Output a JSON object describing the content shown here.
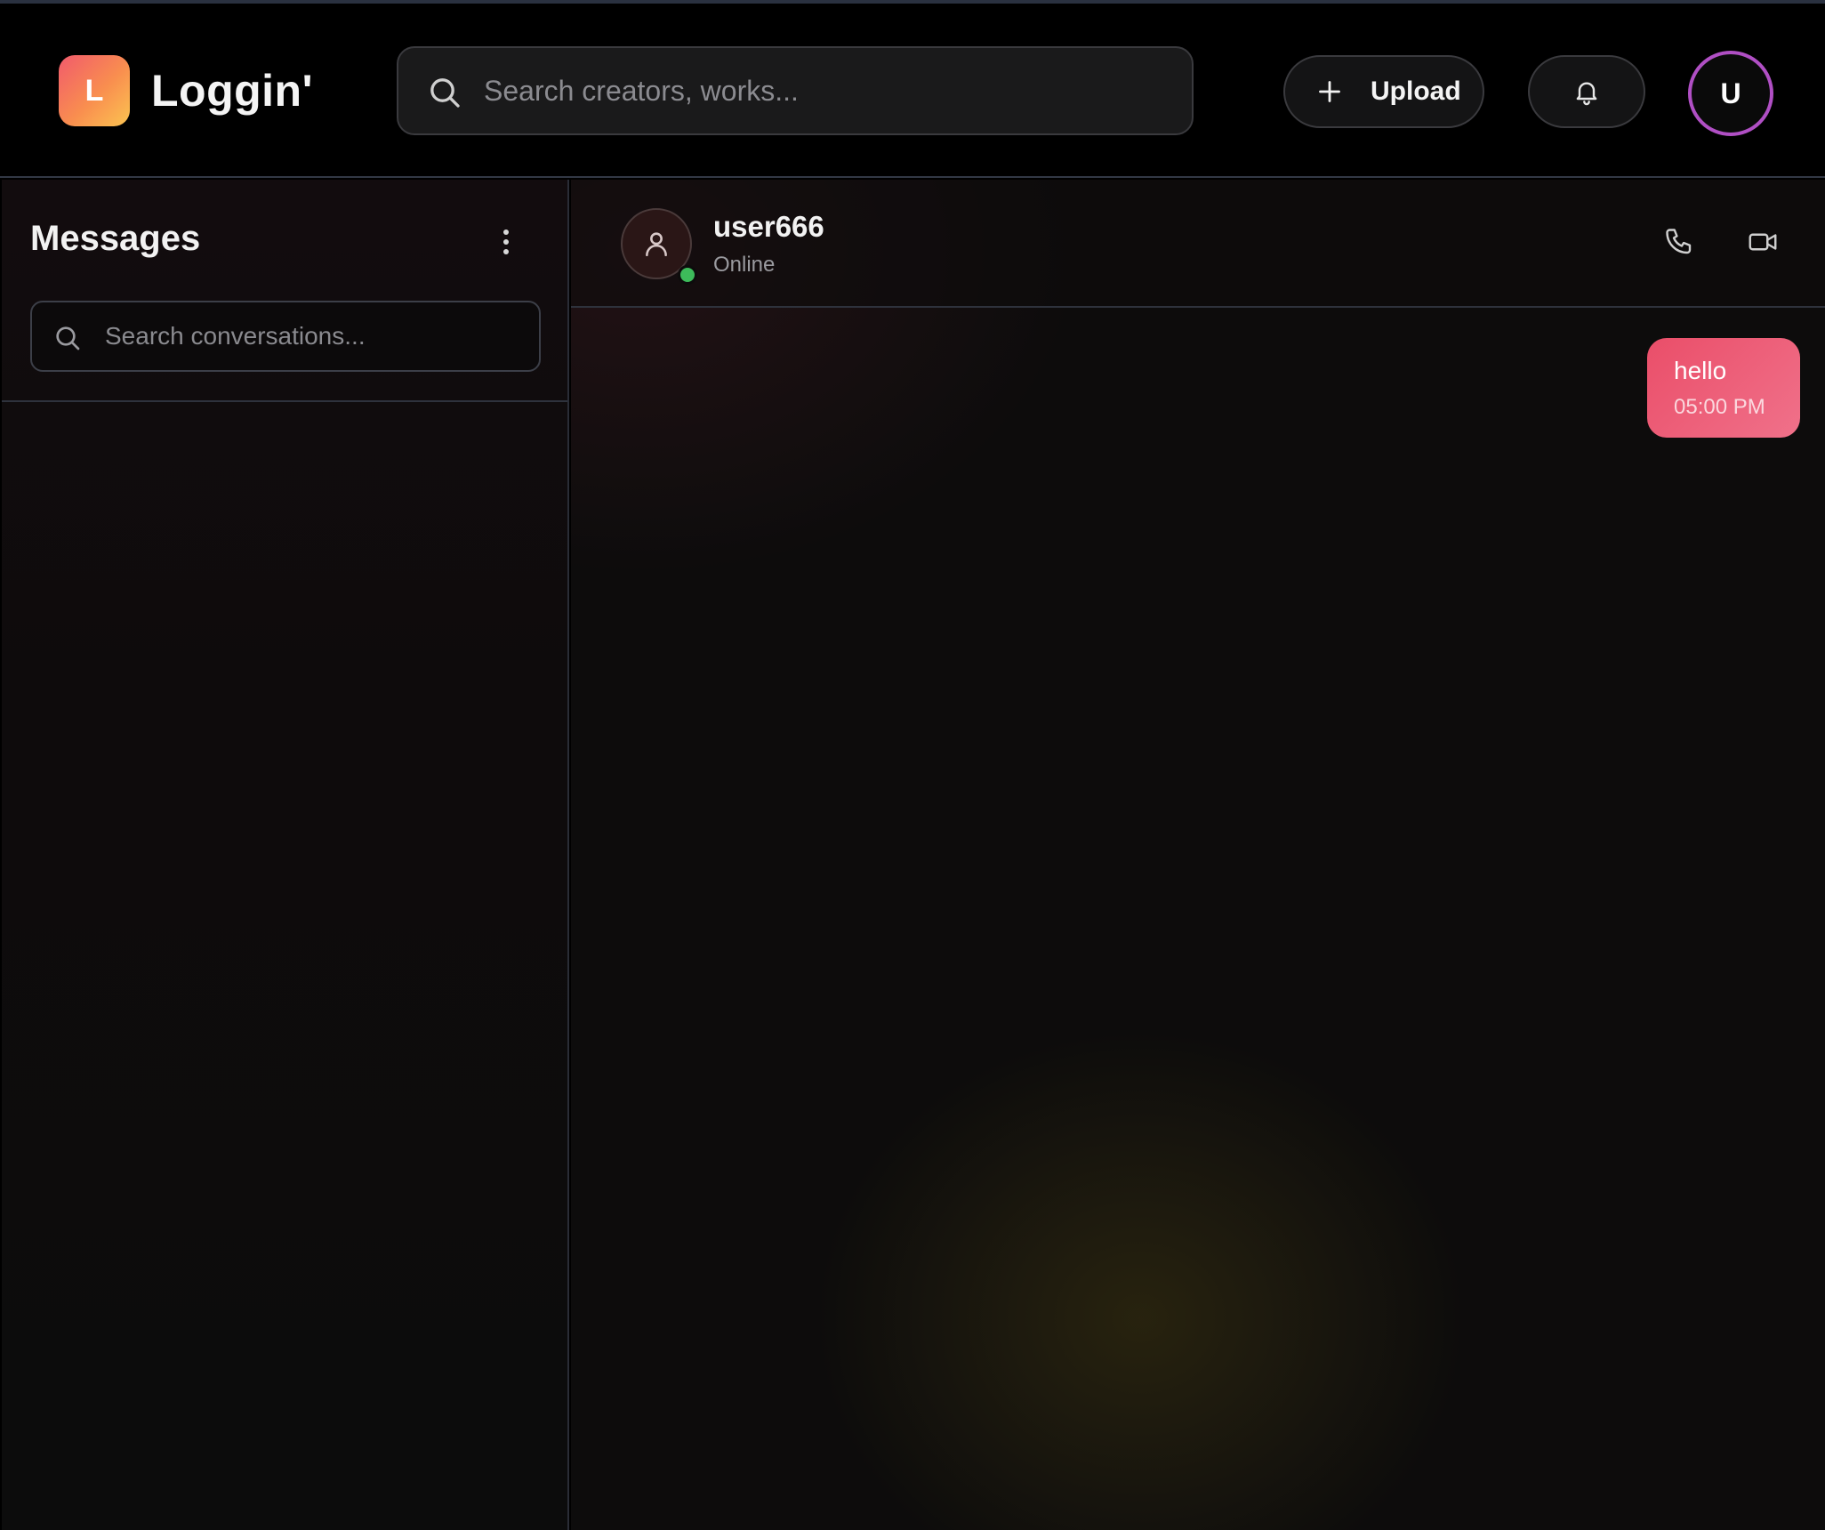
{
  "app": {
    "logo_letter": "L",
    "name": "Loggin'"
  },
  "header": {
    "search_placeholder": "Search creators, works...",
    "upload_label": "Upload",
    "avatar_initial": "U",
    "avatar_ring_color": "#b04fc4"
  },
  "sidebar": {
    "title": "Messages",
    "search_placeholder": "Search conversations..."
  },
  "chat": {
    "contact_name": "user666",
    "contact_status": "Online",
    "status_color": "#3dbb5a",
    "messages": [
      {
        "text": "hello",
        "time": "05:00 PM",
        "from": "me"
      }
    ]
  },
  "colors": {
    "bubble": "#ea4e69",
    "brand_gradient": [
      "#f15a6c",
      "#fbc451"
    ]
  }
}
